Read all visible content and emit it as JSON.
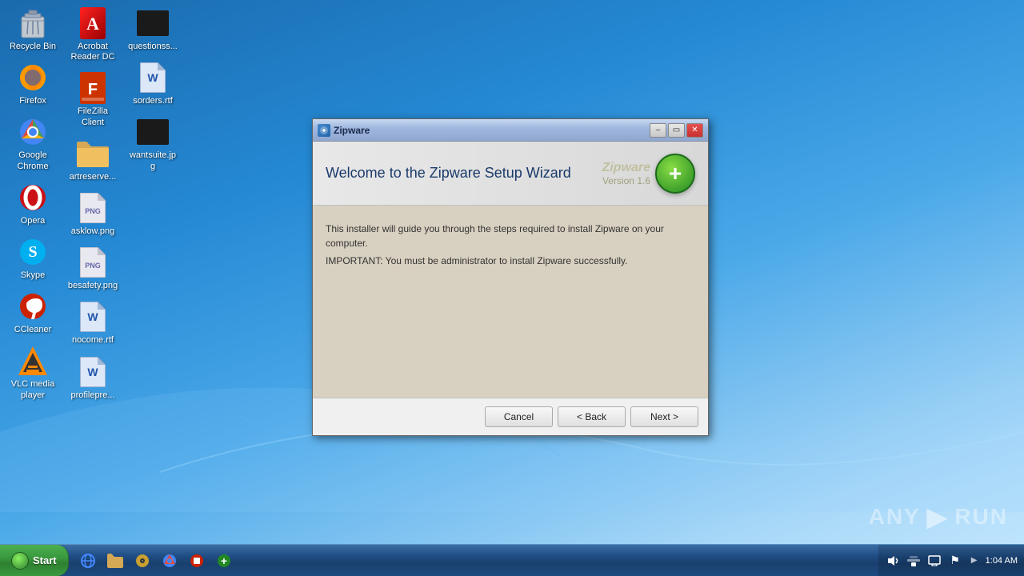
{
  "desktop": {
    "icons_col1": [
      {
        "id": "recycle-bin",
        "label": "Recycle Bin",
        "icon": "recycle"
      },
      {
        "id": "firefox",
        "label": "Firefox",
        "icon": "firefox"
      },
      {
        "id": "google-chrome",
        "label": "Google Chrome",
        "icon": "chrome"
      },
      {
        "id": "opera",
        "label": "Opera",
        "icon": "opera"
      },
      {
        "id": "skype",
        "label": "Skype",
        "icon": "skype"
      },
      {
        "id": "ccleaner",
        "label": "CCleaner",
        "icon": "ccleaner"
      },
      {
        "id": "vlc",
        "label": "VLC media player",
        "icon": "vlc"
      }
    ],
    "icons_col2": [
      {
        "id": "acrobat",
        "label": "Acrobat Reader DC",
        "icon": "acrobat"
      },
      {
        "id": "filezilla",
        "label": "FileZilla Client",
        "icon": "filezilla"
      },
      {
        "id": "artreserve",
        "label": "artreserve...",
        "icon": "folder"
      },
      {
        "id": "asklow",
        "label": "asklow.png",
        "icon": "png"
      },
      {
        "id": "besafety",
        "label": "besafety.png",
        "icon": "png"
      },
      {
        "id": "nocome",
        "label": "nocome.rtf",
        "icon": "word"
      },
      {
        "id": "profilepre",
        "label": "profilepre...",
        "icon": "word"
      }
    ],
    "icons_col3": [
      {
        "id": "questionss",
        "label": "questionss...",
        "icon": "blackbox"
      },
      {
        "id": "sorders",
        "label": "sorders.rtf",
        "icon": "word"
      },
      {
        "id": "wantsuite",
        "label": "wantsuite.jpg",
        "icon": "blackbox"
      }
    ]
  },
  "taskbar": {
    "start_label": "Start",
    "clock": "1:04 AM",
    "icons": [
      "ie",
      "folder",
      "media",
      "chrome",
      "stop",
      "zipware"
    ]
  },
  "dialog": {
    "title": "Zipware",
    "header_title": "Welcome to the Zipware Setup Wizard",
    "logo_text": "Zipware",
    "logo_version": "Version 1.6",
    "logo_icon": "+",
    "body_line1": "This installer will guide you through the steps required to install Zipware on your computer.",
    "body_line2": "IMPORTANT: You must be administrator to install Zipware successfully.",
    "btn_cancel": "Cancel",
    "btn_back": "< Back",
    "btn_next": "Next >"
  },
  "watermark": {
    "text": "ANY",
    "play": "▶",
    "run": "RUN"
  }
}
